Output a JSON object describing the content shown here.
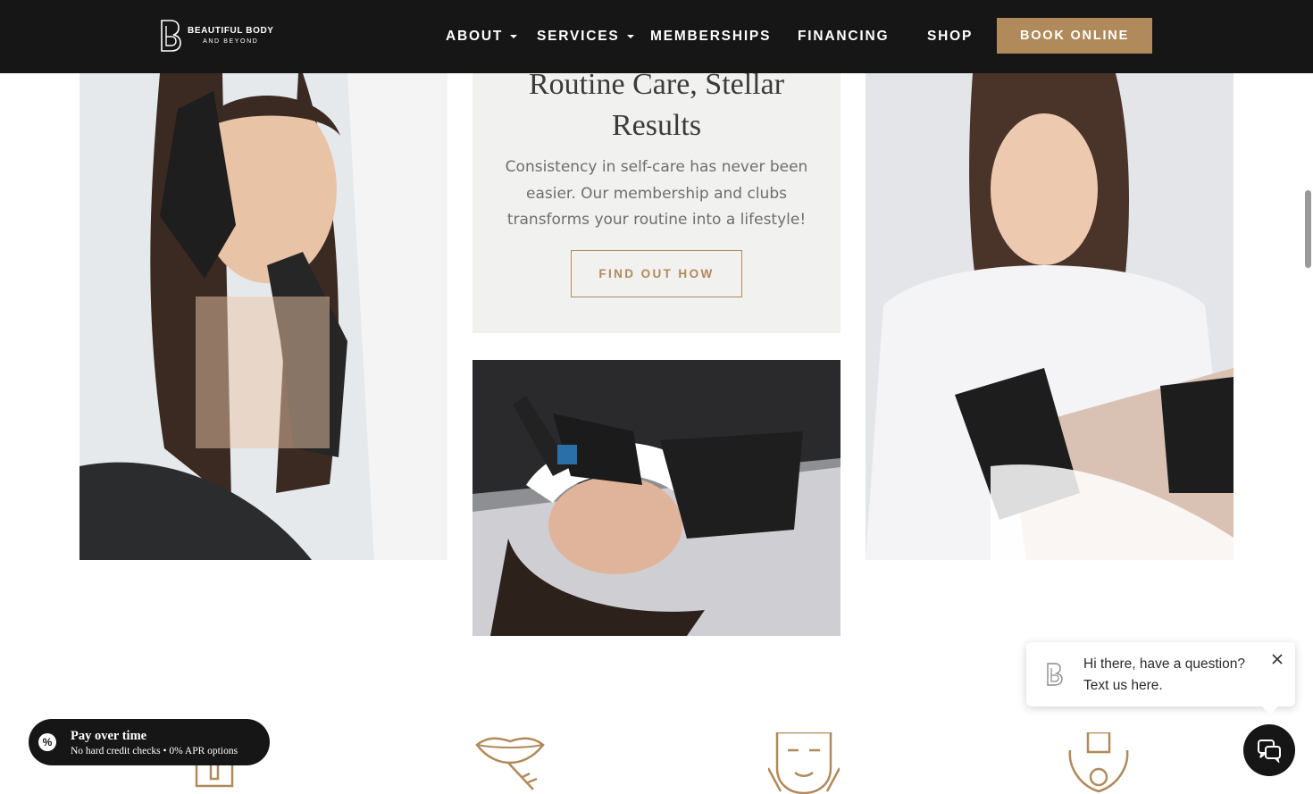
{
  "header": {
    "logo": {
      "line1": "BEAUTIFUL BODY",
      "line2": "AND BEYOND"
    },
    "nav": [
      {
        "label": "ABOUT",
        "dropdown": true
      },
      {
        "label": "SERVICES",
        "dropdown": true
      },
      {
        "label": "MEMBERSHIPS",
        "dropdown": false
      },
      {
        "label": "FINANCING",
        "dropdown": false
      },
      {
        "label": "SHOP",
        "dropdown": false
      }
    ],
    "book_label": "BOOK ONLINE"
  },
  "card": {
    "title": "Routine Care, Stellar Results",
    "text": "Consistency in self-care has never been easier. Our membership and clubs transforms your routine into a lifestyle!",
    "button_label": "FIND OUT HOW"
  },
  "pay": {
    "title": "Pay over time",
    "subtitle": "No hard credit checks • 0% APR options"
  },
  "chat": {
    "message": "Hi there, have a question? Text us here."
  },
  "colors": {
    "header_bg": "#161616",
    "accent": "#b08a5a",
    "card_bg": "#f1f1f0"
  },
  "icons": [
    "percent-icon",
    "close-icon",
    "chat-icon",
    "lips-icon",
    "face-icon",
    "hands-icon",
    "skin-icon"
  ]
}
